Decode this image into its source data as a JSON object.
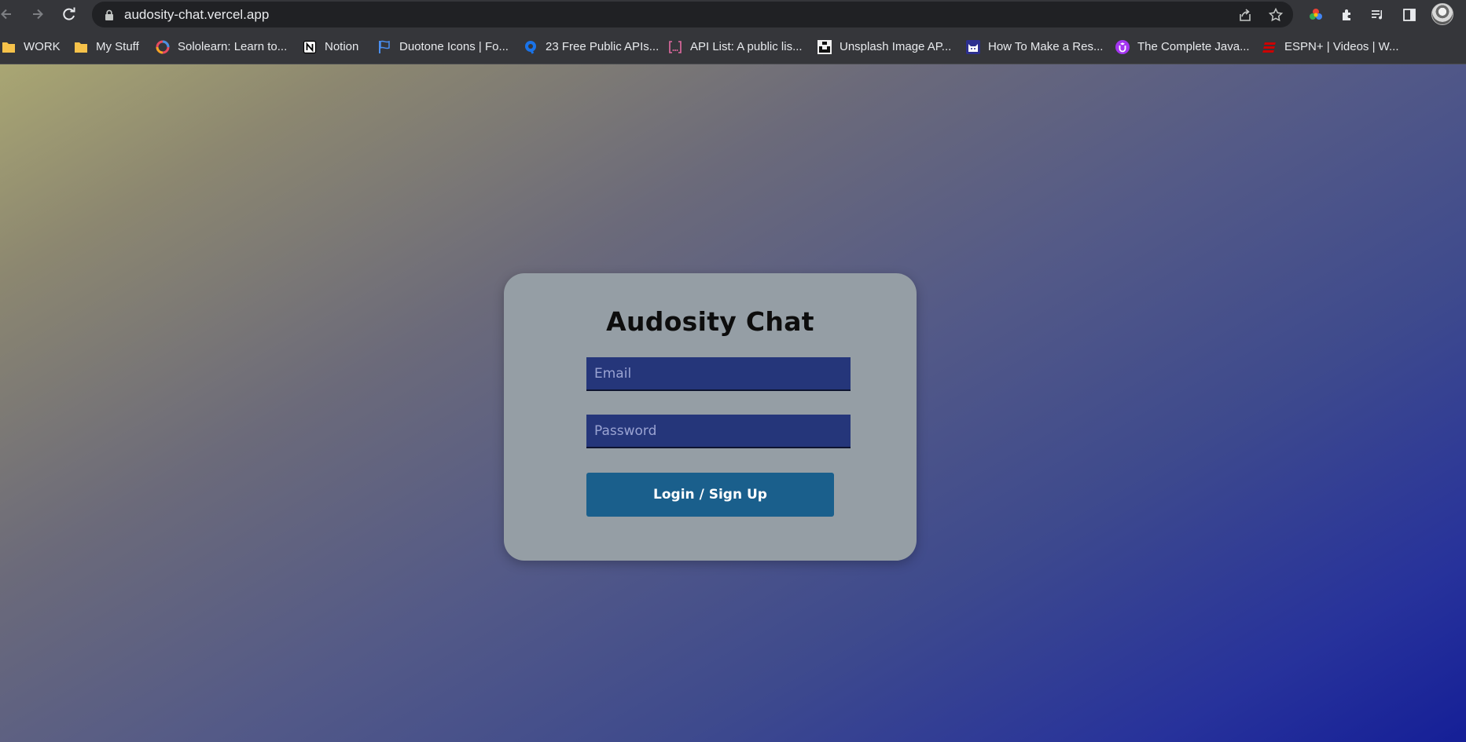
{
  "browser": {
    "url": "audosity-chat.vercel.app",
    "bookmarks": [
      {
        "label": "WORK",
        "icon": "folder-icon",
        "color": "#f6c24a"
      },
      {
        "label": "My Stuff",
        "icon": "folder-icon",
        "color": "#f6c24a"
      },
      {
        "label": "Sololearn: Learn to...",
        "icon": "sololearn-icon",
        "color": "#e84a5f"
      },
      {
        "label": "Notion",
        "icon": "notion-icon",
        "color": "#ffffff"
      },
      {
        "label": "Duotone Icons | Fo...",
        "icon": "flag-icon",
        "color": "#4a8ef0"
      },
      {
        "label": "23 Free Public APIs...",
        "icon": "rapidapi-icon",
        "color": "#1a73e8"
      },
      {
        "label": "API List: A public lis...",
        "icon": "brackets-icon",
        "color": "#e26aa1"
      },
      {
        "label": "Unsplash Image AP...",
        "icon": "unsplash-icon",
        "color": "#111111"
      },
      {
        "label": "How To Make a Res...",
        "icon": "cat-icon",
        "color": "#2c2f8f"
      },
      {
        "label": "The Complete Java...",
        "icon": "udemy-icon",
        "color": "#a435f0"
      },
      {
        "label": "ESPN+ | Videos | W...",
        "icon": "espn-icon",
        "color": "#cc0000"
      }
    ]
  },
  "login": {
    "title": "Audosity Chat",
    "email_placeholder": "Email",
    "password_placeholder": "Password",
    "submit_label": "Login / Sign Up"
  },
  "colors": {
    "card": "#959ea5",
    "input": "#25367a",
    "button": "#1a5f8c",
    "gradient_start": "#a9a673",
    "gradient_end": "#151f97"
  }
}
